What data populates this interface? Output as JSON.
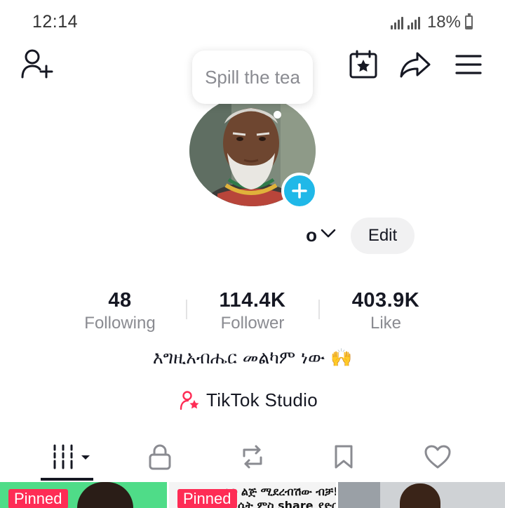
{
  "status_bar": {
    "time": "12:14",
    "battery_percent": "18%"
  },
  "header": {
    "add_friend_icon": "person-add-icon",
    "calendar_icon": "calendar-star-icon",
    "share_icon": "share-arrow-icon",
    "menu_icon": "hamburger-menu-icon"
  },
  "tooltip": {
    "text": "Spill the tea"
  },
  "profile": {
    "username_visible": "o",
    "edit_label": "Edit"
  },
  "stats": [
    {
      "value": "48",
      "label": "Following"
    },
    {
      "value": "114.4K",
      "label": "Follower"
    },
    {
      "value": "403.9K",
      "label": "Like"
    }
  ],
  "bio": {
    "text": "እግዚአብሔር መልካም ነው 🙌"
  },
  "studio": {
    "label": "TikTok Studio"
  },
  "tabs": [
    {
      "icon": "videos-grid-icon",
      "active": true
    },
    {
      "icon": "lock-icon",
      "active": false
    },
    {
      "icon": "repost-icon",
      "active": false
    },
    {
      "icon": "bookmark-icon",
      "active": false
    },
    {
      "icon": "heart-icon",
      "active": false
    }
  ],
  "grid": {
    "pinned_label": "Pinned",
    "item2_line1": "ወንድ ልጅ ሚደረብሽው ብቻ!",
    "item2_line2": "ሴት ምስ share ያድርጉ"
  },
  "colors": {
    "accent_red": "#fe2c55",
    "plus_blue": "#20b8e8",
    "text_primary": "#161823",
    "text_secondary": "#8a8b91"
  }
}
